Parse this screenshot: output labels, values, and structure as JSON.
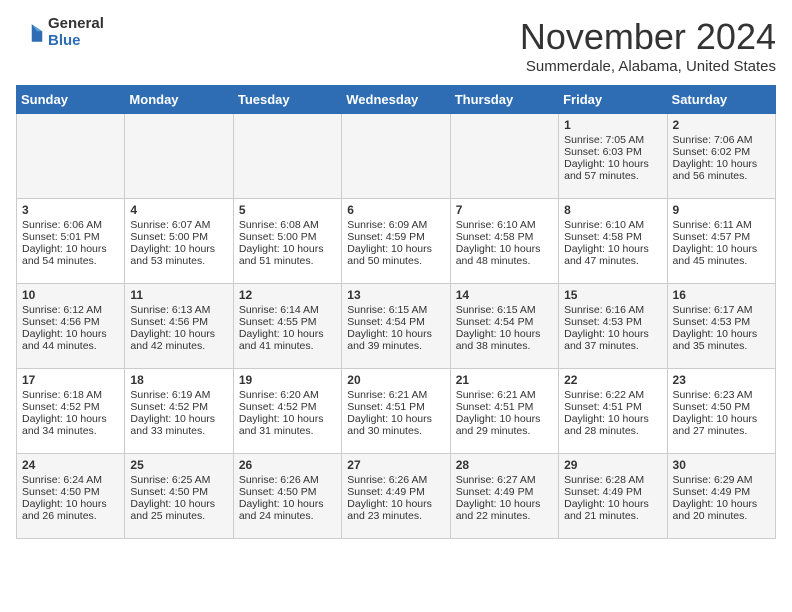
{
  "logo": {
    "general": "General",
    "blue": "Blue"
  },
  "header": {
    "month": "November 2024",
    "location": "Summerdale, Alabama, United States"
  },
  "weekdays": [
    "Sunday",
    "Monday",
    "Tuesday",
    "Wednesday",
    "Thursday",
    "Friday",
    "Saturday"
  ],
  "weeks": [
    [
      {
        "day": "",
        "info": ""
      },
      {
        "day": "",
        "info": ""
      },
      {
        "day": "",
        "info": ""
      },
      {
        "day": "",
        "info": ""
      },
      {
        "day": "",
        "info": ""
      },
      {
        "day": "1",
        "info": "Sunrise: 7:05 AM\nSunset: 6:03 PM\nDaylight: 10 hours and 57 minutes."
      },
      {
        "day": "2",
        "info": "Sunrise: 7:06 AM\nSunset: 6:02 PM\nDaylight: 10 hours and 56 minutes."
      }
    ],
    [
      {
        "day": "3",
        "info": "Sunrise: 6:06 AM\nSunset: 5:01 PM\nDaylight: 10 hours and 54 minutes."
      },
      {
        "day": "4",
        "info": "Sunrise: 6:07 AM\nSunset: 5:00 PM\nDaylight: 10 hours and 53 minutes."
      },
      {
        "day": "5",
        "info": "Sunrise: 6:08 AM\nSunset: 5:00 PM\nDaylight: 10 hours and 51 minutes."
      },
      {
        "day": "6",
        "info": "Sunrise: 6:09 AM\nSunset: 4:59 PM\nDaylight: 10 hours and 50 minutes."
      },
      {
        "day": "7",
        "info": "Sunrise: 6:10 AM\nSunset: 4:58 PM\nDaylight: 10 hours and 48 minutes."
      },
      {
        "day": "8",
        "info": "Sunrise: 6:10 AM\nSunset: 4:58 PM\nDaylight: 10 hours and 47 minutes."
      },
      {
        "day": "9",
        "info": "Sunrise: 6:11 AM\nSunset: 4:57 PM\nDaylight: 10 hours and 45 minutes."
      }
    ],
    [
      {
        "day": "10",
        "info": "Sunrise: 6:12 AM\nSunset: 4:56 PM\nDaylight: 10 hours and 44 minutes."
      },
      {
        "day": "11",
        "info": "Sunrise: 6:13 AM\nSunset: 4:56 PM\nDaylight: 10 hours and 42 minutes."
      },
      {
        "day": "12",
        "info": "Sunrise: 6:14 AM\nSunset: 4:55 PM\nDaylight: 10 hours and 41 minutes."
      },
      {
        "day": "13",
        "info": "Sunrise: 6:15 AM\nSunset: 4:54 PM\nDaylight: 10 hours and 39 minutes."
      },
      {
        "day": "14",
        "info": "Sunrise: 6:15 AM\nSunset: 4:54 PM\nDaylight: 10 hours and 38 minutes."
      },
      {
        "day": "15",
        "info": "Sunrise: 6:16 AM\nSunset: 4:53 PM\nDaylight: 10 hours and 37 minutes."
      },
      {
        "day": "16",
        "info": "Sunrise: 6:17 AM\nSunset: 4:53 PM\nDaylight: 10 hours and 35 minutes."
      }
    ],
    [
      {
        "day": "17",
        "info": "Sunrise: 6:18 AM\nSunset: 4:52 PM\nDaylight: 10 hours and 34 minutes."
      },
      {
        "day": "18",
        "info": "Sunrise: 6:19 AM\nSunset: 4:52 PM\nDaylight: 10 hours and 33 minutes."
      },
      {
        "day": "19",
        "info": "Sunrise: 6:20 AM\nSunset: 4:52 PM\nDaylight: 10 hours and 31 minutes."
      },
      {
        "day": "20",
        "info": "Sunrise: 6:21 AM\nSunset: 4:51 PM\nDaylight: 10 hours and 30 minutes."
      },
      {
        "day": "21",
        "info": "Sunrise: 6:21 AM\nSunset: 4:51 PM\nDaylight: 10 hours and 29 minutes."
      },
      {
        "day": "22",
        "info": "Sunrise: 6:22 AM\nSunset: 4:51 PM\nDaylight: 10 hours and 28 minutes."
      },
      {
        "day": "23",
        "info": "Sunrise: 6:23 AM\nSunset: 4:50 PM\nDaylight: 10 hours and 27 minutes."
      }
    ],
    [
      {
        "day": "24",
        "info": "Sunrise: 6:24 AM\nSunset: 4:50 PM\nDaylight: 10 hours and 26 minutes."
      },
      {
        "day": "25",
        "info": "Sunrise: 6:25 AM\nSunset: 4:50 PM\nDaylight: 10 hours and 25 minutes."
      },
      {
        "day": "26",
        "info": "Sunrise: 6:26 AM\nSunset: 4:50 PM\nDaylight: 10 hours and 24 minutes."
      },
      {
        "day": "27",
        "info": "Sunrise: 6:26 AM\nSunset: 4:49 PM\nDaylight: 10 hours and 23 minutes."
      },
      {
        "day": "28",
        "info": "Sunrise: 6:27 AM\nSunset: 4:49 PM\nDaylight: 10 hours and 22 minutes."
      },
      {
        "day": "29",
        "info": "Sunrise: 6:28 AM\nSunset: 4:49 PM\nDaylight: 10 hours and 21 minutes."
      },
      {
        "day": "30",
        "info": "Sunrise: 6:29 AM\nSunset: 4:49 PM\nDaylight: 10 hours and 20 minutes."
      }
    ]
  ]
}
